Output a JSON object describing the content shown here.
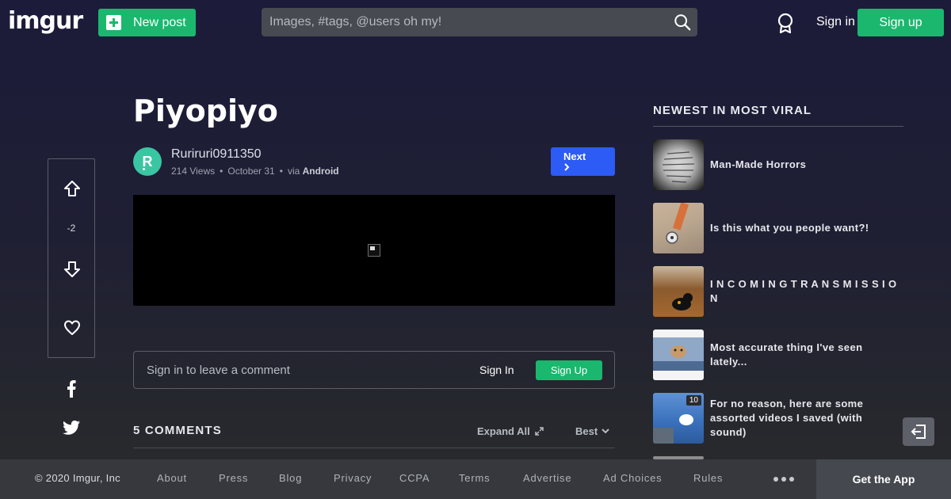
{
  "header": {
    "logo_text": "imgur",
    "new_post_label": "New post",
    "search_placeholder": "Images, #tags, @users oh my!",
    "signin_label": "Sign in",
    "signup_label": "Sign up"
  },
  "post": {
    "title": "Piyopiyo",
    "author": "Ruriruri0911350",
    "avatar_letter": "R",
    "views": "214 Views",
    "date": "October 31",
    "via_prefix": "via",
    "via_source": "Android",
    "next_label": "Next",
    "score": "-2"
  },
  "comment_box": {
    "placeholder": "Sign in to leave a comment",
    "signin_label": "Sign In",
    "signup_label": "Sign Up"
  },
  "comments": {
    "header": "5 COMMENTS",
    "expand_label": "Expand All",
    "sort_label": "Best"
  },
  "rail": {
    "title": "NEWEST IN MOST VIRAL",
    "items": [
      {
        "title": "Man-Made Horrors",
        "badge": ""
      },
      {
        "title": "Is this what you people want?!",
        "badge": ""
      },
      {
        "title": "I N C O M I N G T R A N S M I S S I O N",
        "badge": ""
      },
      {
        "title": "Most accurate thing I've seen lately...",
        "badge": ""
      },
      {
        "title": "For no reason, here are some assorted videos I saved (with sound)",
        "badge": "10"
      }
    ]
  },
  "footer": {
    "copyright": "© 2020 Imgur, Inc",
    "links": [
      "About",
      "Press",
      "Blog",
      "Privacy",
      "CCPA",
      "Terms",
      "Advertise",
      "Ad Choices",
      "Rules"
    ],
    "get_app_label": "Get the App"
  },
  "colors": {
    "brand_green": "#1bb76e",
    "next_blue": "#2c5bf5",
    "avatar_teal": "#3ac6a2"
  }
}
